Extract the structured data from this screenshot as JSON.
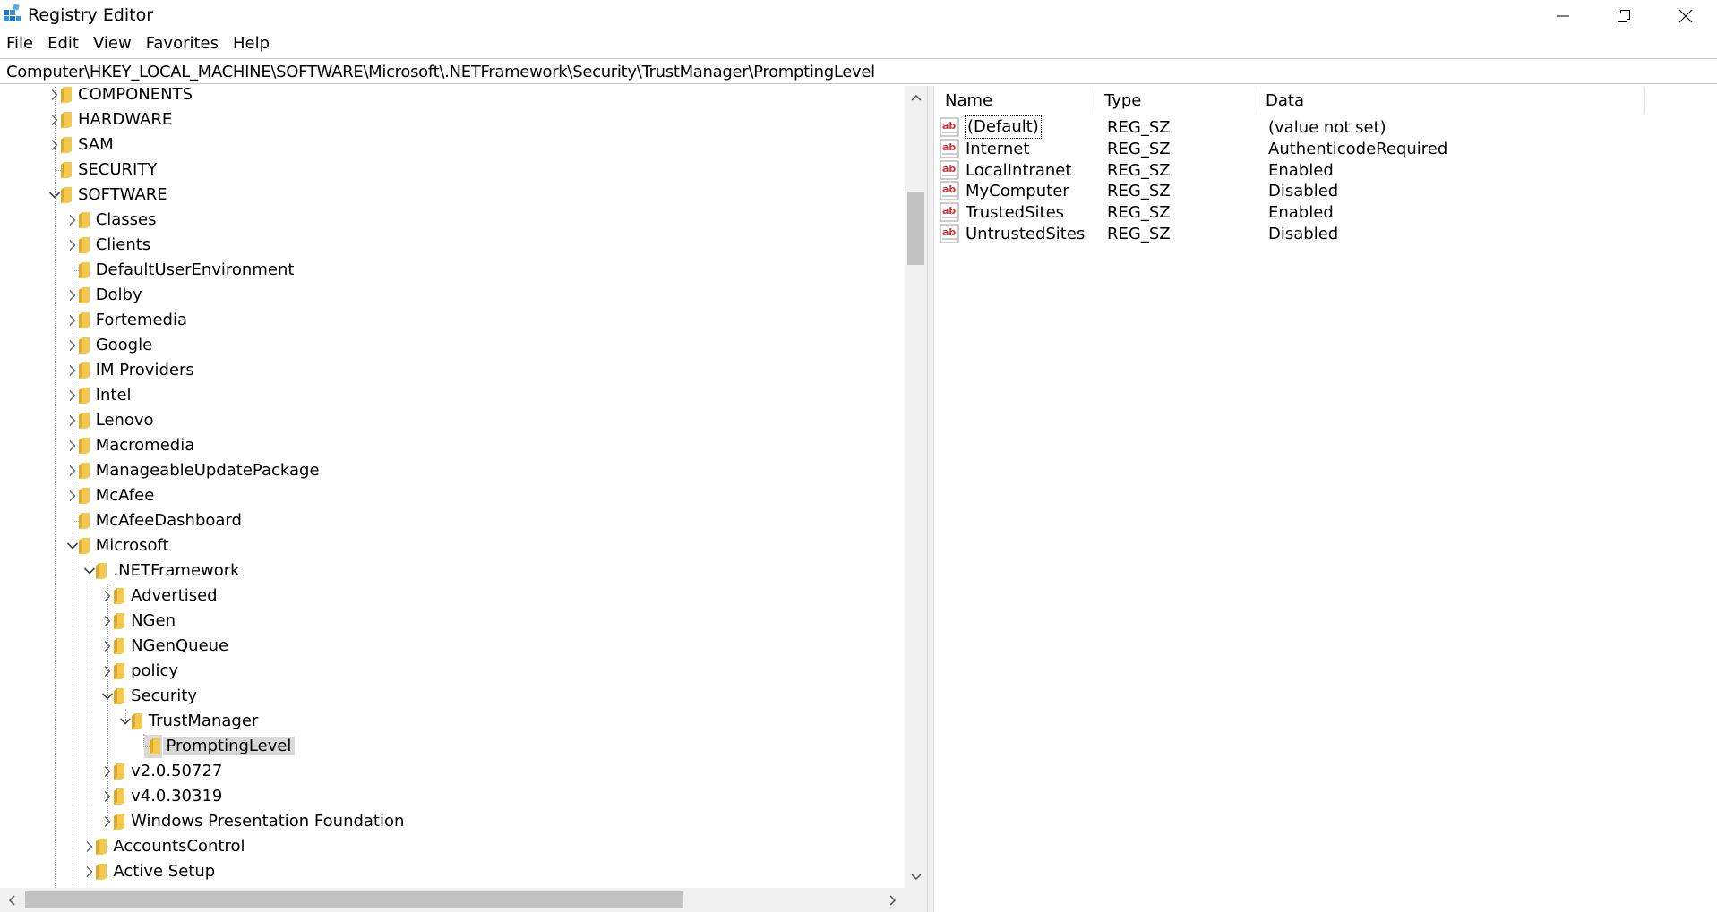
{
  "window": {
    "title": "Registry Editor",
    "icon": "registry-editor-icon"
  },
  "menu": [
    "File",
    "Edit",
    "View",
    "Favorites",
    "Help"
  ],
  "address": "Computer\\HKEY_LOCAL_MACHINE\\SOFTWARE\\Microsoft\\.NETFramework\\Security\\TrustManager\\PromptingLevel",
  "tree": [
    {
      "label": "COMPONENTS",
      "depth": 0,
      "state": "collapsed"
    },
    {
      "label": "HARDWARE",
      "depth": 0,
      "state": "collapsed"
    },
    {
      "label": "SAM",
      "depth": 0,
      "state": "collapsed"
    },
    {
      "label": "SECURITY",
      "depth": 0,
      "state": "leaf"
    },
    {
      "label": "SOFTWARE",
      "depth": 0,
      "state": "expanded"
    },
    {
      "label": "Classes",
      "depth": 1,
      "state": "collapsed"
    },
    {
      "label": "Clients",
      "depth": 1,
      "state": "collapsed"
    },
    {
      "label": "DefaultUserEnvironment",
      "depth": 1,
      "state": "leaf"
    },
    {
      "label": "Dolby",
      "depth": 1,
      "state": "collapsed"
    },
    {
      "label": "Fortemedia",
      "depth": 1,
      "state": "collapsed"
    },
    {
      "label": "Google",
      "depth": 1,
      "state": "collapsed"
    },
    {
      "label": "IM Providers",
      "depth": 1,
      "state": "collapsed"
    },
    {
      "label": "Intel",
      "depth": 1,
      "state": "collapsed"
    },
    {
      "label": "Lenovo",
      "depth": 1,
      "state": "collapsed"
    },
    {
      "label": "Macromedia",
      "depth": 1,
      "state": "collapsed"
    },
    {
      "label": "ManageableUpdatePackage",
      "depth": 1,
      "state": "collapsed"
    },
    {
      "label": "McAfee",
      "depth": 1,
      "state": "collapsed"
    },
    {
      "label": "McAfeeDashboard",
      "depth": 1,
      "state": "leaf"
    },
    {
      "label": "Microsoft",
      "depth": 1,
      "state": "expanded"
    },
    {
      "label": ".NETFramework",
      "depth": 2,
      "state": "expanded"
    },
    {
      "label": "Advertised",
      "depth": 3,
      "state": "collapsed"
    },
    {
      "label": "NGen",
      "depth": 3,
      "state": "collapsed"
    },
    {
      "label": "NGenQueue",
      "depth": 3,
      "state": "collapsed"
    },
    {
      "label": "policy",
      "depth": 3,
      "state": "collapsed"
    },
    {
      "label": "Security",
      "depth": 3,
      "state": "expanded"
    },
    {
      "label": "TrustManager",
      "depth": 4,
      "state": "expanded"
    },
    {
      "label": "PromptingLevel",
      "depth": 5,
      "state": "leaf",
      "selected": true
    },
    {
      "label": "v2.0.50727",
      "depth": 3,
      "state": "collapsed"
    },
    {
      "label": "v4.0.30319",
      "depth": 3,
      "state": "collapsed"
    },
    {
      "label": "Windows Presentation Foundation",
      "depth": 3,
      "state": "collapsed"
    },
    {
      "label": "AccountsControl",
      "depth": 2,
      "state": "collapsed"
    },
    {
      "label": "Active Setup",
      "depth": 2,
      "state": "collapsed"
    }
  ],
  "columns": {
    "name": "Name",
    "type": "Type",
    "data": "Data"
  },
  "values": [
    {
      "name": "(Default)",
      "type": "REG_SZ",
      "data": "(value not set)",
      "focused": true
    },
    {
      "name": "Internet",
      "type": "REG_SZ",
      "data": "AuthenticodeRequired"
    },
    {
      "name": "LocalIntranet",
      "type": "REG_SZ",
      "data": "Enabled"
    },
    {
      "name": "MyComputer",
      "type": "REG_SZ",
      "data": "Disabled"
    },
    {
      "name": "TrustedSites",
      "type": "REG_SZ",
      "data": "Enabled"
    },
    {
      "name": "UntrustedSites",
      "type": "REG_SZ",
      "data": "Disabled"
    }
  ],
  "colors": {
    "folder": "#f2c94c",
    "folder_dark": "#dcaa2e",
    "selection": "#d9d9d9",
    "string_icon_red": "#d13438",
    "app_icon_blue": "#1e73c8"
  }
}
